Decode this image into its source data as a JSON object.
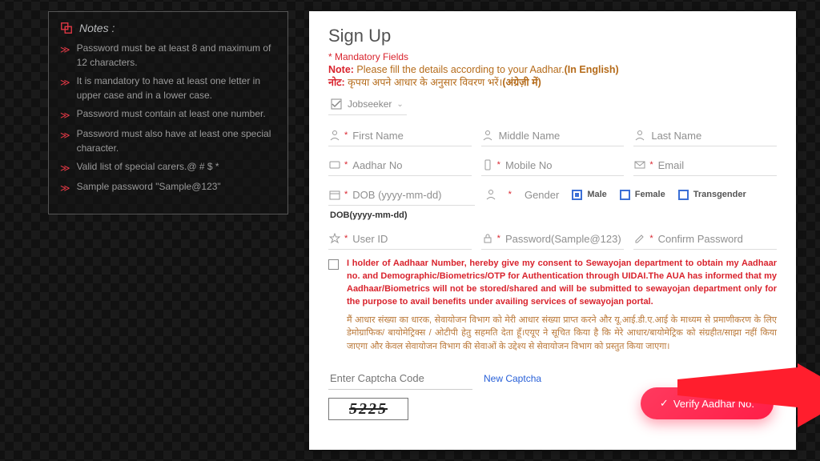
{
  "notes": {
    "title": "Notes :",
    "items": [
      "Password must be at least 8 and maximum of 12 characters.",
      "It is mandatory to have at least one letter in upper case and in a lower case.",
      "Password must contain at least one number.",
      "Password must also have at least one special character.",
      "Valid list of special carers.@ # $ *",
      "Sample password \"Sample@123\""
    ]
  },
  "form": {
    "title": "Sign Up",
    "mandatory": "* Mandatory Fields",
    "note_en_lead": "Note:",
    "note_en_rest": " Please fill the details according to your Aadhar.",
    "note_en_bold": "(In English)",
    "note_hi_lead": "नोट:",
    "note_hi_rest": " कृपया अपने आधार के अनुसार विवरण भरें।",
    "note_hi_bold": "(अंग्रेज़ी में)",
    "role": "Jobseeker",
    "first_name": "First Name",
    "middle_name": "Middle Name",
    "last_name": "Last Name",
    "aadhar": "Aadhar No",
    "mobile": "Mobile No",
    "email": "Email",
    "dob": "DOB (yyyy-mm-dd)",
    "dob_hint": "DOB(yyyy-mm-dd)",
    "gender_label": "Gender",
    "gender": {
      "male": "Male",
      "female": "Female",
      "trans": "Transgender"
    },
    "user_id": "User ID",
    "password": "Password(Sample@123)",
    "confirm": "Confirm Password",
    "consent_en": "I holder of Aadhaar Number, hereby give my consent to Sewayojan department to obtain my Aadhaar no. and Demographic/Biometrics/OTP for Authentication through UIDAI.The AUA has informed that my Aadhaar/Biometrics will not be stored/shared and will be submitted to sewayojan department only for the purpose to avail benefits under availing services of sewayojan portal.",
    "consent_hi": "मैं आधार संख्या का धारक, सेवायोजन विभाग को मेरी आधार संख्या प्राप्त करने और यू.आई.डी.ए.आई के माध्यम से प्रमाणीकरण के लिए डेमोग्राफिक/ बायोमेट्रिक्स / ओटीपी हेतु सहमति देता हूँ।एयूए ने सूचित किया है कि मेरे आधार/बायोमेट्रिक को संग्रहीत/साझा नहीं किया जाएगा और केवल सेवायोजन विभाग की सेवाओं के उद्देश्य से सेवायोजन विभाग को प्रस्तुत किया जाएगा।",
    "captcha_ph": "Enter Captcha Code",
    "new_captcha": "New Captcha",
    "captcha_val": "5225",
    "verify": "Verify Aadhar No."
  }
}
